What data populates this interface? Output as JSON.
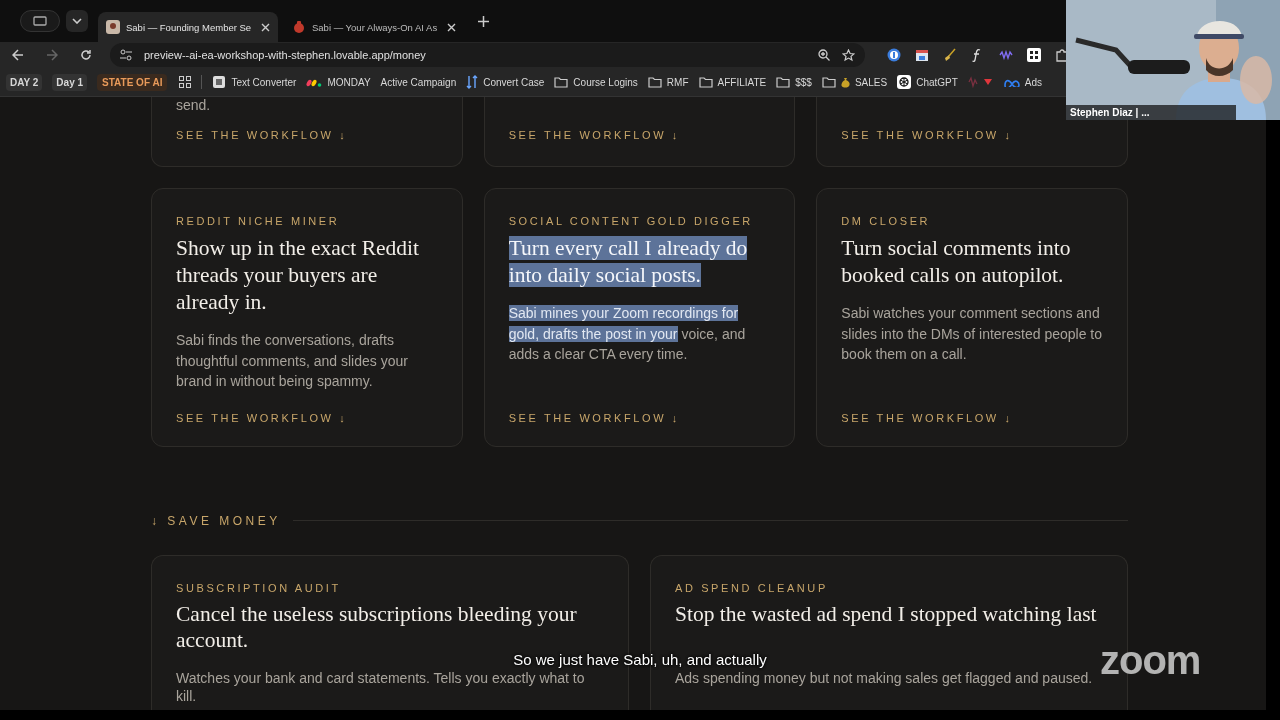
{
  "browser": {
    "tabs": [
      {
        "title": "Sabi — Founding Member Se",
        "selected": true
      },
      {
        "title": "Sabi — Your Always-On AI As",
        "selected": false
      }
    ],
    "url": "preview--ai-ea-workshop-with-stephen.lovable.app/money",
    "bookmarks": [
      {
        "label": "DAY 2",
        "kind": "chip"
      },
      {
        "label": "Day 1",
        "kind": "chip"
      },
      {
        "label": "STATE OF AI",
        "kind": "highlight"
      },
      {
        "kind": "apps"
      },
      {
        "label": "Text Converter",
        "kind": "page"
      },
      {
        "label": "MONDAY",
        "kind": "monday"
      },
      {
        "label": "Active Campaign",
        "kind": "plain"
      },
      {
        "label": "Convert Case",
        "kind": "convert"
      },
      {
        "label": "Course Logins",
        "kind": "folder"
      },
      {
        "label": "RMF",
        "kind": "folder"
      },
      {
        "label": "AFFILIATE",
        "kind": "folder"
      },
      {
        "label": "$$$",
        "kind": "folder"
      },
      {
        "label": "SALES",
        "kind": "money-folder"
      },
      {
        "label": "ChatGPT",
        "kind": "chatgpt"
      },
      {
        "kind": "red"
      },
      {
        "label": "Ads",
        "kind": "meta"
      }
    ]
  },
  "page": {
    "top_cards": [
      {
        "description_end": "send.",
        "link": "SEE THE WORKFLOW ↓"
      },
      {
        "link": "SEE THE WORKFLOW ↓"
      },
      {
        "link": "SEE THE WORKFLOW ↓"
      }
    ],
    "cards": [
      {
        "label": "REDDIT NICHE MINER",
        "title": "Show up in the exact Reddit threads your buyers are already in.",
        "title_selected": false,
        "description": [
          {
            "text": "Sabi finds the conversations, drafts thoughtful comments, and slides your brand in without being spammy.",
            "selected": false
          }
        ],
        "link": "SEE THE WORKFLOW ↓"
      },
      {
        "label": "SOCIAL CONTENT GOLD DIGGER",
        "title": "Turn every call I already do into daily social posts.",
        "title_selected": true,
        "description": [
          {
            "text": "Sabi mines your Zoom recordings for gold, drafts the post in your",
            "selected": true
          },
          {
            "text": " voice, and adds a clear CTA every time.",
            "selected": false
          }
        ],
        "link": "SEE THE WORKFLOW ↓"
      },
      {
        "label": "DM CLOSER",
        "title": "Turn social comments into booked calls on autopilot.",
        "title_selected": false,
        "description": [
          {
            "text": "Sabi watches your comment sections and slides into the DMs of interested people to book them on a call.",
            "selected": false
          }
        ],
        "link": "SEE THE WORKFLOW ↓"
      }
    ],
    "section": {
      "heading": "↓ SAVE MONEY",
      "cards": [
        {
          "label": "SUBSCRIPTION AUDIT",
          "title": "Cancel the useless subscriptions bleeding your account.",
          "description": "Watches your bank and card statements. Tells you exactly what to kill."
        },
        {
          "label": "AD SPEND CLEANUP",
          "title": "Stop the wasted ad spend I stopped watching last",
          "description": "Ads spending money but not making sales get flagged and paused."
        }
      ]
    }
  },
  "meeting": {
    "name": "Stephen Diaz | ...",
    "caption": "So we just have Sabi, uh, and actually",
    "logo": "zoom"
  }
}
